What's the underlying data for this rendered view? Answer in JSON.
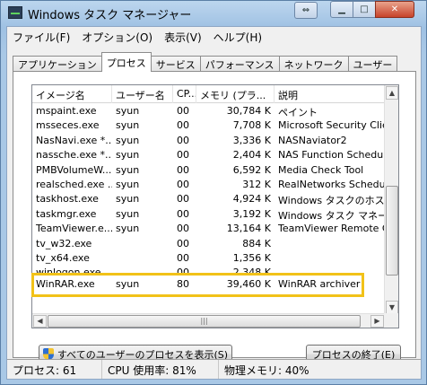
{
  "window": {
    "title": "Windows タスク マネージャー"
  },
  "menu": [
    "ファイル(F)",
    "オプション(O)",
    "表示(V)",
    "ヘルプ(H)"
  ],
  "tabs": [
    "アプリケーション",
    "プロセス",
    "サービス",
    "パフォーマンス",
    "ネットワーク",
    "ユーザー"
  ],
  "active_tab": "プロセス",
  "columns": [
    "イメージ名",
    "ユーザー名",
    "CP...",
    "メモリ (プラ...",
    "説明"
  ],
  "rows": [
    {
      "name": "mspaint.exe",
      "user": "syun",
      "cpu": "00",
      "mem": "30,784 K",
      "desc": "ペイント"
    },
    {
      "name": "msseces.exe",
      "user": "syun",
      "cpu": "00",
      "mem": "7,708 K",
      "desc": "Microsoft Security Clien..."
    },
    {
      "name": "NasNavi.exe *...",
      "user": "syun",
      "cpu": "00",
      "mem": "3,336 K",
      "desc": "NASNaviator2"
    },
    {
      "name": "nassche.exe *...",
      "user": "syun",
      "cpu": "00",
      "mem": "2,404 K",
      "desc": "NAS Function Schedulin..."
    },
    {
      "name": "PMBVolumeW...",
      "user": "syun",
      "cpu": "00",
      "mem": "6,592 K",
      "desc": "Media Check Tool"
    },
    {
      "name": "realsched.exe ...",
      "user": "syun",
      "cpu": "00",
      "mem": "312 K",
      "desc": "RealNetworks Scheduler"
    },
    {
      "name": "taskhost.exe",
      "user": "syun",
      "cpu": "00",
      "mem": "4,924 K",
      "desc": "Windows タスクのホスト プ..."
    },
    {
      "name": "taskmgr.exe",
      "user": "syun",
      "cpu": "00",
      "mem": "3,192 K",
      "desc": "Windows タスク マネージャ..."
    },
    {
      "name": "TeamViewer.e...",
      "user": "syun",
      "cpu": "00",
      "mem": "13,164 K",
      "desc": "TeamViewer Remote Co..."
    },
    {
      "name": "tv_w32.exe",
      "user": "",
      "cpu": "00",
      "mem": "884 K",
      "desc": ""
    },
    {
      "name": "tv_x64.exe",
      "user": "",
      "cpu": "00",
      "mem": "1,356 K",
      "desc": ""
    },
    {
      "name": "winlogon.exe",
      "user": "",
      "cpu": "00",
      "mem": "2,348 K",
      "desc": ""
    },
    {
      "name": "WinRAR.exe",
      "user": "syun",
      "cpu": "80",
      "mem": "39,460 K",
      "desc": "WinRAR archiver"
    }
  ],
  "buttons": {
    "show_all": "すべてのユーザーのプロセスを表示(S)",
    "end_process": "プロセスの終了(E)"
  },
  "status": {
    "processes": "プロセス: 61",
    "cpu": "CPU 使用率: 81%",
    "memory": "物理メモリ: 40%"
  },
  "colors": {
    "highlight_border": "#f2c218"
  },
  "icons": [
    "task-manager-app-icon",
    "window-swap-icon",
    "minimize-icon",
    "maximize-icon",
    "close-icon",
    "uac-shield-icon"
  ]
}
